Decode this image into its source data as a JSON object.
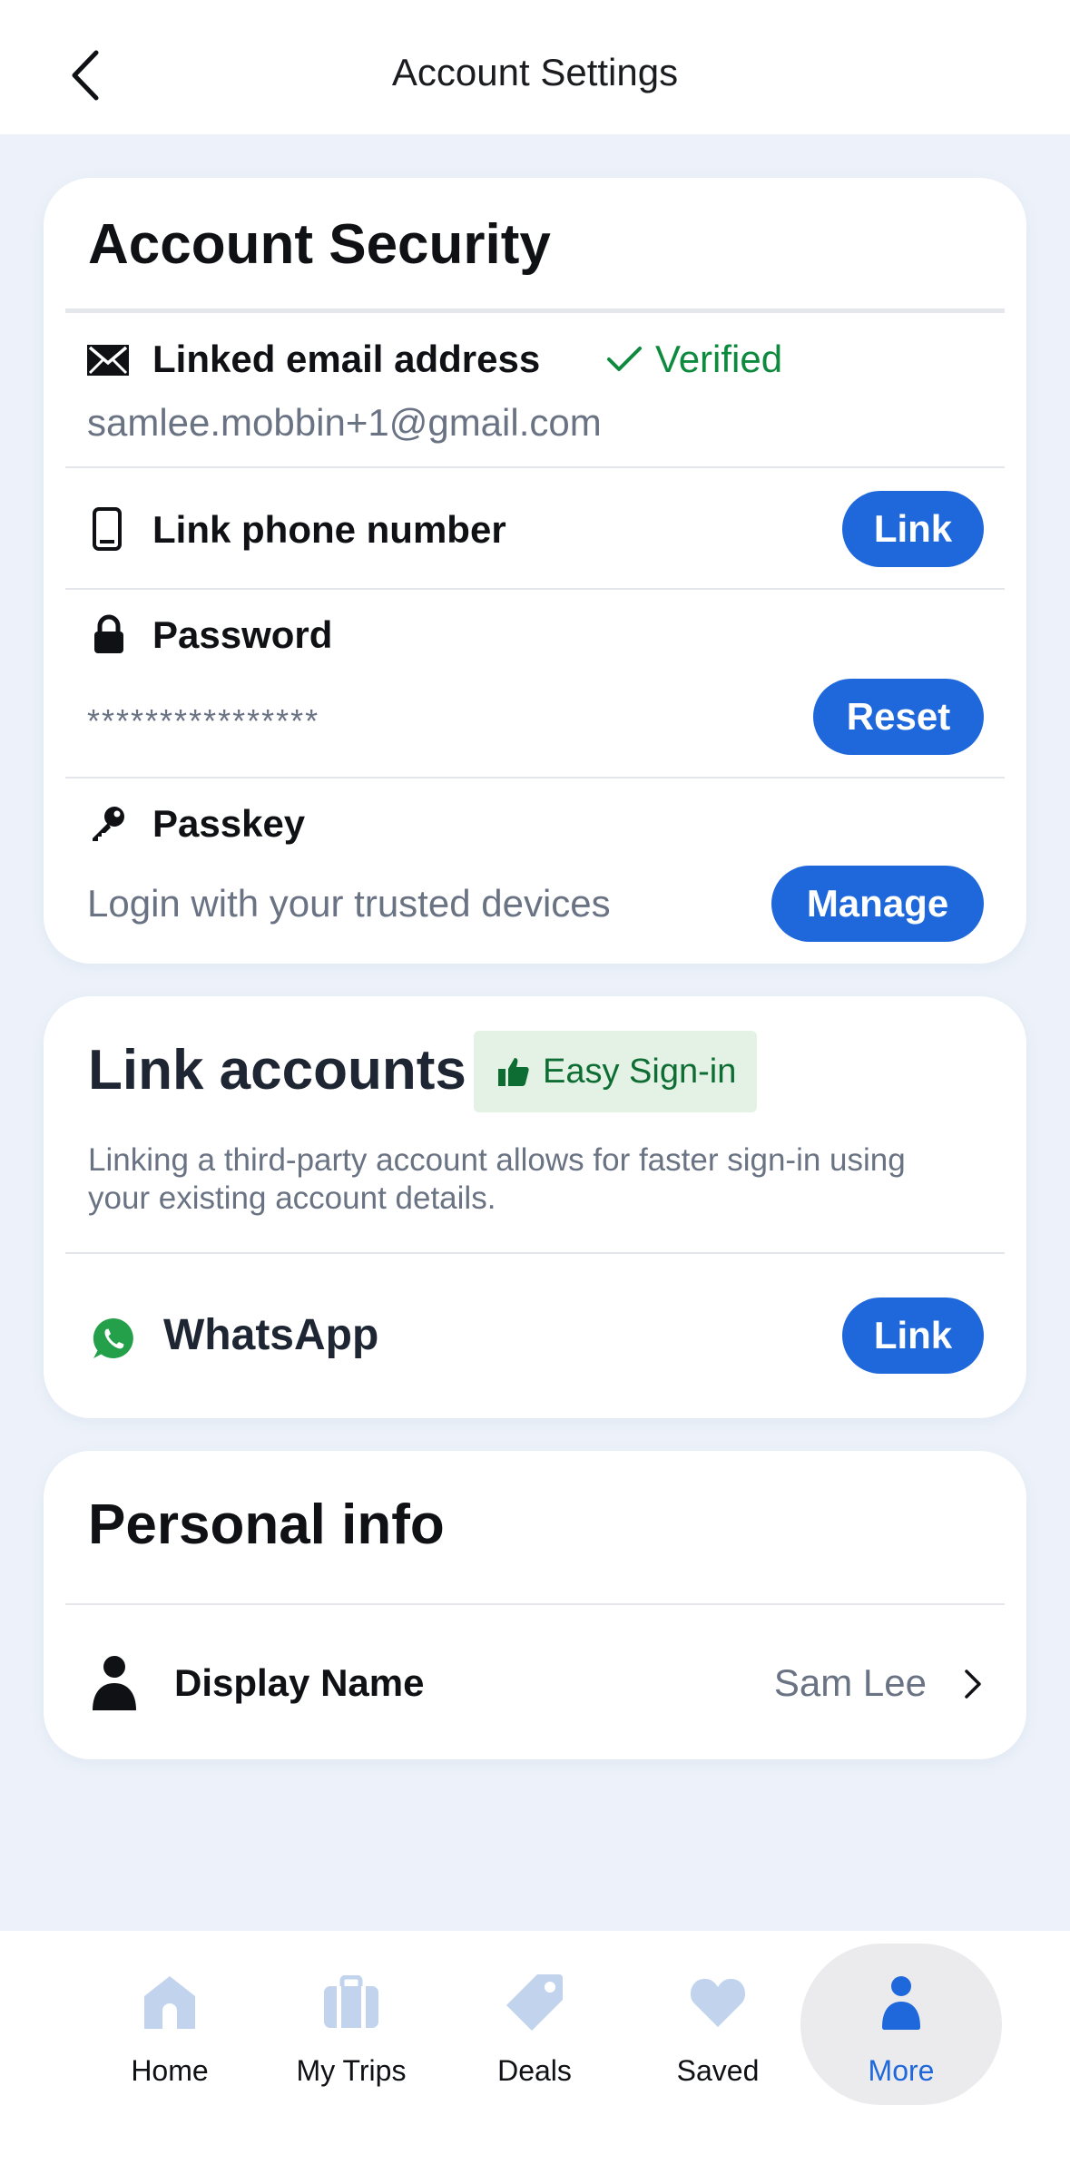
{
  "header": {
    "title": "Account Settings",
    "back_icon": "chevron-left-icon"
  },
  "security": {
    "title": "Account Security",
    "email": {
      "label": "Linked email address",
      "status": "Verified",
      "value": "samlee.mobbin+1@gmail.com",
      "icon": "envelope-icon"
    },
    "phone": {
      "label": "Link phone number",
      "button": "Link",
      "icon": "phone-icon"
    },
    "password": {
      "label": "Password",
      "masked": "****************",
      "button": "Reset",
      "icon": "lock-icon"
    },
    "passkey": {
      "label": "Passkey",
      "description": "Login with your trusted devices",
      "button": "Manage",
      "icon": "key-icon"
    }
  },
  "link_accounts": {
    "title": "Link accounts",
    "badge": "Easy Sign-in",
    "description": "Linking a third-party account allows for faster sign-in using your existing account details.",
    "whatsapp": {
      "label": "WhatsApp",
      "button": "Link",
      "icon": "whatsapp-icon"
    }
  },
  "personal": {
    "title": "Personal info",
    "display_name": {
      "label": "Display Name",
      "value": "Sam Lee",
      "icon": "person-icon"
    }
  },
  "tabs": [
    {
      "label": "Home",
      "icon": "home-icon",
      "active": false
    },
    {
      "label": "My Trips",
      "icon": "suitcase-icon",
      "active": false
    },
    {
      "label": "Deals",
      "icon": "tag-icon",
      "active": false
    },
    {
      "label": "Saved",
      "icon": "heart-icon",
      "active": false
    },
    {
      "label": "More",
      "icon": "person-icon",
      "active": true
    }
  ],
  "colors": {
    "accent": "#1f68dc",
    "verified": "#0d8a3e",
    "background": "#edf2fa",
    "tab_inactive_icon": "#c2d4ed",
    "whatsapp": "#25a04a"
  }
}
